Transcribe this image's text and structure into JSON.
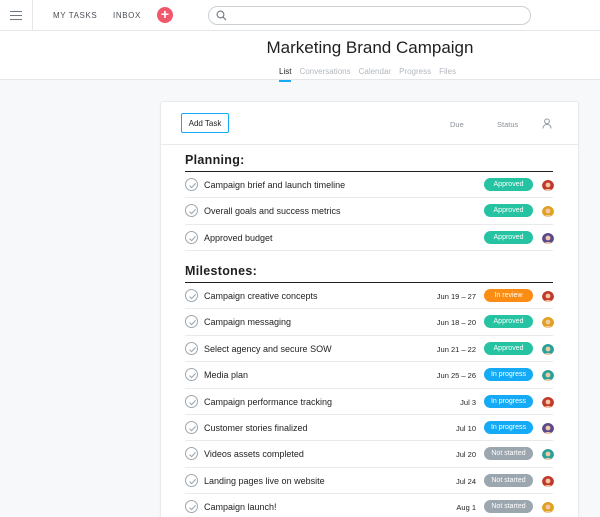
{
  "topbar": {
    "nav": [
      "MY TASKS",
      "INBOX"
    ],
    "add_symbol": "+",
    "search_placeholder": ""
  },
  "project": {
    "title": "Marketing Brand Campaign",
    "tabs": [
      "List",
      "Conversations",
      "Calendar",
      "Progress",
      "Files"
    ],
    "active_tab": "List"
  },
  "list": {
    "add_task_label": "Add Task",
    "col_due": "Due",
    "col_status": "Status",
    "sections": [
      {
        "title": "Planning:",
        "tasks": [
          {
            "name": "Campaign brief and launch timeline",
            "due": "",
            "status": "Approved",
            "avatar_color": "#c0392b"
          },
          {
            "name": "Overall goals and success metrics",
            "due": "",
            "status": "Approved",
            "avatar_color": "#e0a020"
          },
          {
            "name": "Approved budget",
            "due": "",
            "status": "Approved",
            "avatar_color": "#5b4a8b"
          }
        ]
      },
      {
        "title": "Milestones:",
        "tasks": [
          {
            "name": "Campaign creative concepts",
            "due": "Jun 19 – 27",
            "status": "In review",
            "avatar_color": "#c0392b"
          },
          {
            "name": "Campaign messaging",
            "due": "Jun 18 – 20",
            "status": "Approved",
            "avatar_color": "#e0a020"
          },
          {
            "name": "Select agency and secure SOW",
            "due": "Jun 21 – 22",
            "status": "Approved",
            "avatar_color": "#2aa198"
          },
          {
            "name": "Media plan",
            "due": "Jun 25 – 26",
            "status": "In progress",
            "avatar_color": "#2aa198"
          },
          {
            "name": "Campaign performance tracking",
            "due": "Jul 3",
            "status": "In progress",
            "avatar_color": "#c0392b"
          },
          {
            "name": "Customer stories finalized",
            "due": "Jul 10",
            "status": "In progress",
            "avatar_color": "#5b4a8b"
          },
          {
            "name": "Videos assets completed",
            "due": "Jul 20",
            "status": "Not started",
            "avatar_color": "#2aa198"
          },
          {
            "name": "Landing pages live on website",
            "due": "Jul 24",
            "status": "Not started",
            "avatar_color": "#c0392b"
          },
          {
            "name": "Campaign launch!",
            "due": "Aug 1",
            "status": "Not started",
            "avatar_color": "#e0a020"
          }
        ]
      }
    ]
  },
  "status_colors": {
    "Approved": "#25c3a1",
    "In review": "#fb8d14",
    "In progress": "#14aaf5",
    "Not started": "#9ca6af"
  },
  "accent_color": "#14aaf5",
  "add_button_color": "#f0586b"
}
